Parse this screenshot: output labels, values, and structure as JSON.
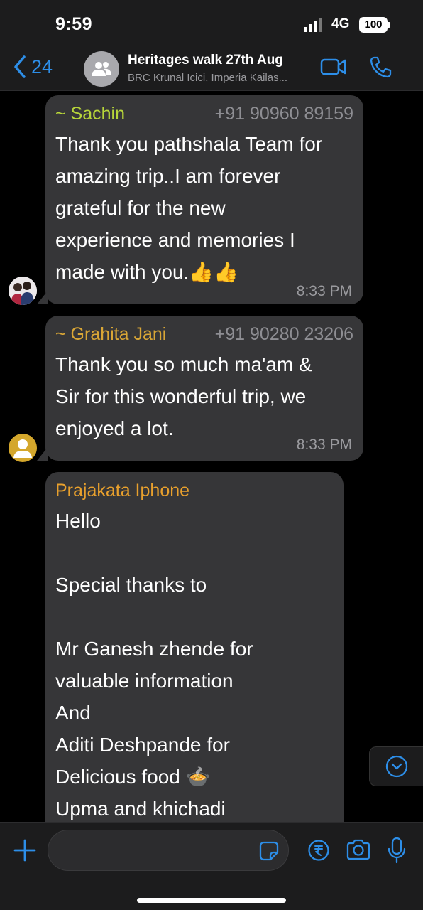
{
  "status_bar": {
    "time": "9:59",
    "network": "4G",
    "battery": "100"
  },
  "header": {
    "back_count": "24",
    "group_name": "Heritages walk 27th Aug",
    "members": "BRC Krunal Icici, Imperia Kailas..."
  },
  "messages": [
    {
      "sender": "~ Sachin",
      "sender_color": "#b7d53a",
      "phone": "+91 90960 89159",
      "text": "Thank  you pathshala Team for\namazing trip..I am forever\ngrateful for the new\nexperience and memories I\nmade with you.👍👍",
      "time": "8:33 PM"
    },
    {
      "sender": "~ Grahita Jani",
      "sender_color": "#d9a636",
      "phone": "+91 90280 23206",
      "text": "Thank you so much ma'am &\nSir for this wonderful trip, we\nenjoyed a lot.",
      "time": "8:33 PM"
    },
    {
      "sender": "Prajakata Iphone",
      "sender_color": "#e8a02d",
      "text": "Hello\n\nSpecial thanks to\n\nMr Ganesh zhende for\nvaluable information\nAnd\nAditi Deshpande for\nDelicious food 🍲\nUpma and khichadi"
    }
  ],
  "icons": {
    "back": "chevron-left-icon",
    "group_avatar": "group-icon",
    "video": "video-camera-icon",
    "call": "phone-icon",
    "scroll_down": "chevron-down-circle-icon",
    "plus": "plus-icon",
    "sticker": "sticker-icon",
    "rupee": "rupee-icon",
    "camera": "camera-icon",
    "mic": "microphone-icon"
  },
  "colors": {
    "accent": "#2d8ee8",
    "bubble": "#363638",
    "background": "#000000"
  }
}
